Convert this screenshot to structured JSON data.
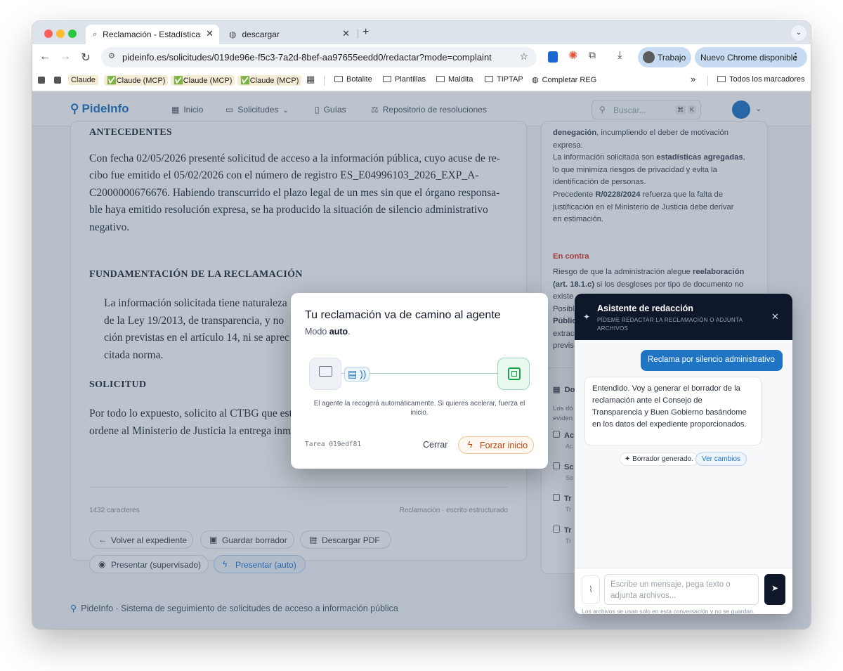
{
  "browser": {
    "tabs": [
      {
        "title": "Reclamación - Estadísticas de",
        "active": true
      },
      {
        "title": "descargar",
        "active": false
      }
    ],
    "url": "pideinfo.es/solicitudes/019de96e-f5c3-7a2d-8bef-aa97655eedd0/redactar?mode=complaint",
    "profile_label": "Trabajo",
    "update_label": "Nuevo Chrome disponible"
  },
  "bookmarks": {
    "items": [
      "Claude",
      "✅Claude (MCP)",
      "✅Claude (MCP)",
      "✅Claude (MCP)",
      "Botalite",
      "Plantillas",
      "Maldita",
      "TIPTAP",
      "Completar REG"
    ],
    "overflow": "»",
    "all_bookmarks": "Todos los marcadores"
  },
  "app": {
    "logo": "PideInfo",
    "nav": [
      "Inicio",
      "Solicitudes",
      "Guías",
      "Repositorio de resoluciones"
    ],
    "search_placeholder": "Buscar...",
    "kbd": [
      "⌘",
      "K"
    ]
  },
  "document": {
    "heading_antecedentes": "ANTECEDENTES",
    "antecedentes_lines": [
      "Con fecha 02/05/2026 presenté solicitud de acceso a la información pública, cuyo acuse de re-",
      "cibo fue emitido el 05/02/2026 con el número de registro ES_E04996103_2026_EXP_A-",
      "C2000000676676. Habiendo transcurrido el plazo legal de un mes sin que el órgano responsa-",
      "ble haya emitido resolución expresa, se ha producido la situación de silencio administrativo",
      "negativo."
    ],
    "heading_fundamentacion": "FUNDAMENTACIÓN DE LA RECLAMACIÓN",
    "fundamentacion_lines": [
      "La información solicitada tiene naturaleza",
      "de la Ley 19/2013, de transparencia, y no",
      "ción previstas en el artículo 14, ni se aprec",
      "citada norma."
    ],
    "heading_solicitud": "SOLICITUD",
    "solicitud_lines": [
      "Por todo lo expuesto, solicito al CTBG que est",
      "ordene al Ministerio de Justicia la entrega inm"
    ],
    "char_count": "1432 caracteres",
    "doc_type": "Reclamación · escrito estructurado",
    "buttons": {
      "back": "Volver al expediente",
      "save": "Guardar borrador",
      "pdf": "Descargar PDF",
      "supervised": "Presentar (supervisado)",
      "auto": "Presentar (auto)"
    }
  },
  "sidebar": {
    "favor_lines": [
      {
        "bold": "denegación",
        "rest": ", incumpliendo el deber de motivación"
      },
      {
        "bold": "",
        "rest": "expresa."
      },
      {
        "bold": "",
        "rest": "La información solicitada son "
      },
      {
        "bold": "",
        "rest": "lo que minimiza riesgos de privacidad y evita la"
      },
      {
        "bold": "",
        "rest": "identificación de personas."
      },
      {
        "bold": "",
        "rest": "Precedente "
      },
      {
        "bold": "",
        "rest": "justificación en el Ministerio de Justicia debe derivar"
      },
      {
        "bold": "",
        "rest": "en estimación."
      }
    ],
    "stats_bold": "estadísticas agregadas",
    "precedent_bold": "R/0228/2024",
    "precedent_rest": " refuerza que la falta de",
    "contra_title": "En contra",
    "contra_lines": [
      {
        "pre": "Riesgo de que la administración alegue ",
        "bold": "reelaboración"
      },
      {
        "pre": "",
        "bold": "(art. 18.1.c)",
        "post": " si los desgloses por tipo de documento no"
      },
      {
        "pre": "existe",
        "bold": ""
      },
      {
        "pre": "Posibl",
        "bold": ""
      },
      {
        "pre": "",
        "bold": "Públic"
      },
      {
        "pre": "extrac",
        "bold": ""
      },
      {
        "pre": "previs",
        "bold": ""
      }
    ],
    "docs_title": "Do",
    "docs_desc": [
      "Los do",
      "eviden"
    ],
    "checklist": [
      {
        "title": "Ac",
        "sub": "Ac"
      },
      {
        "title": "Sc",
        "sub": "So"
      },
      {
        "title": "Tr",
        "sub": "Tr"
      },
      {
        "title": "Tr",
        "sub": "Tr"
      }
    ]
  },
  "footer": {
    "text": "PideInfo · Sistema de seguimiento de solicitudes de acceso a información pública"
  },
  "chat": {
    "title": "Asistente de redacción",
    "subtitle_1": "PÍDEME REDACTAR LA RECLAMACIÓN O ADJUNTA",
    "subtitle_2": "ARCHIVOS",
    "user_message": "Reclama por silencio administrativo",
    "assistant_lines": [
      "Entendido. Voy a generar el borrador de la",
      "reclamación ante el Consejo de",
      "Transparencia y Buen Gobierno basándome",
      "en los datos del expediente proporcionados."
    ],
    "draft_generated": "✦ Borrador generado.",
    "view_changes": "Ver cambios",
    "input_placeholder_1": "Escribe un mensaje, pega texto o",
    "input_placeholder_2": "adjunta archivos...",
    "note": "Los archivos se usan solo en esta conversación y no se guardan."
  },
  "modal": {
    "title": "Tu reclamación va de camino al agente",
    "mode_prefix": "Modo ",
    "mode_value": "auto",
    "mode_suffix": ".",
    "info_line_1": "El agente la recogerá automáticamente. Si quieres acelerar, fuerza el",
    "info_line_2": "inicio.",
    "task_label": "Tarea 019edf81",
    "close_label": "Cerrar",
    "force_label": "Forzar inicio"
  },
  "colors": {
    "brand": "#1f74c4",
    "danger": "#d93025",
    "accent_orange": "#e8711a",
    "agent_green": "#16a34a"
  }
}
